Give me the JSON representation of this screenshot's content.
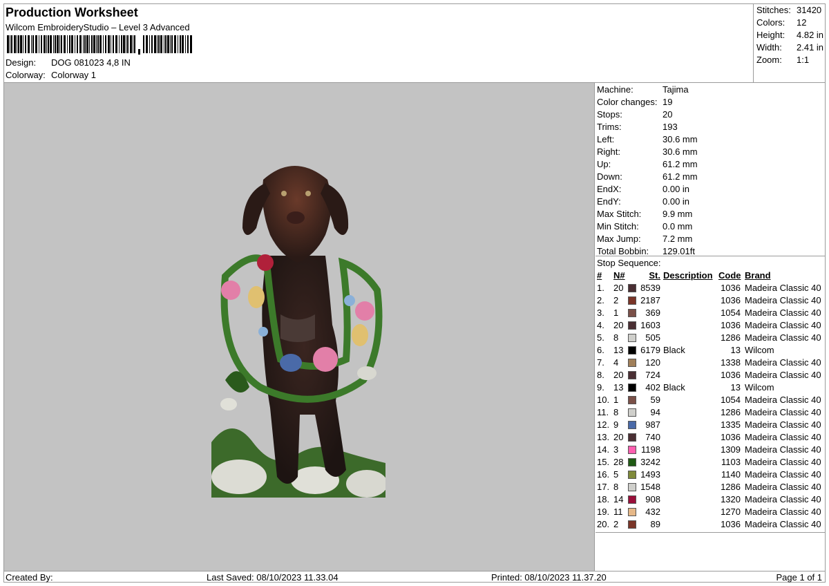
{
  "header": {
    "title": "Production Worksheet",
    "subtitle": "Wilcom EmbroideryStudio – Level 3 Advanced",
    "design_label": "Design:",
    "design_value": "DOG 081023 4,8 IN",
    "colorway_label": "Colorway:",
    "colorway_value": "Colorway 1"
  },
  "summary": [
    {
      "label": "Stitches:",
      "value": "31420"
    },
    {
      "label": "Colors:",
      "value": "12"
    },
    {
      "label": "Height:",
      "value": "4.82 in"
    },
    {
      "label": "Width:",
      "value": "2.41 in"
    },
    {
      "label": "Zoom:",
      "value": "1:1"
    }
  ],
  "machine": [
    {
      "label": "Machine:",
      "value": "Tajima"
    },
    {
      "label": "Color changes:",
      "value": "19"
    },
    {
      "label": "Stops:",
      "value": "20"
    },
    {
      "label": "Trims:",
      "value": "193"
    },
    {
      "label": "Left:",
      "value": "30.6 mm"
    },
    {
      "label": "Right:",
      "value": "30.6 mm"
    },
    {
      "label": "Up:",
      "value": "61.2 mm"
    },
    {
      "label": "Down:",
      "value": "61.2 mm"
    },
    {
      "label": "EndX:",
      "value": "0.00 in"
    },
    {
      "label": "EndY:",
      "value": "0.00 in"
    },
    {
      "label": "Max Stitch:",
      "value": "9.9 mm"
    },
    {
      "label": "Min Stitch:",
      "value": "0.0 mm"
    },
    {
      "label": "Max Jump:",
      "value": "7.2 mm"
    },
    {
      "label": "Total Bobbin:",
      "value": "129.01ft"
    }
  ],
  "stop_sequence": {
    "title": "Stop Sequence:",
    "headers": {
      "num": "#",
      "n": "N#",
      "st": "St.",
      "desc": "Description",
      "code": "Code",
      "brand": "Brand"
    },
    "rows": [
      {
        "num": "1.",
        "n": "20",
        "color": "#4a2f33",
        "st": "8539",
        "desc": "",
        "code": "1036",
        "brand": "Madeira Classic 40"
      },
      {
        "num": "2.",
        "n": "2",
        "color": "#7a3528",
        "st": "2187",
        "desc": "",
        "code": "1036",
        "brand": "Madeira Classic 40"
      },
      {
        "num": "3.",
        "n": "1",
        "color": "#7a5048",
        "st": "369",
        "desc": "",
        "code": "1054",
        "brand": "Madeira Classic 40"
      },
      {
        "num": "4.",
        "n": "20",
        "color": "#4a2f33",
        "st": "1603",
        "desc": "",
        "code": "1036",
        "brand": "Madeira Classic 40"
      },
      {
        "num": "5.",
        "n": "8",
        "color": "#cfcfcb",
        "st": "505",
        "desc": "",
        "code": "1286",
        "brand": "Madeira Classic 40"
      },
      {
        "num": "6.",
        "n": "13",
        "color": "#000000",
        "st": "6179",
        "desc": "Black",
        "code": "13",
        "brand": "Wilcom"
      },
      {
        "num": "7.",
        "n": "4",
        "color": "#a07f5a",
        "st": "120",
        "desc": "",
        "code": "1338",
        "brand": "Madeira Classic 40"
      },
      {
        "num": "8.",
        "n": "20",
        "color": "#4a2f33",
        "st": "724",
        "desc": "",
        "code": "1036",
        "brand": "Madeira Classic 40"
      },
      {
        "num": "9.",
        "n": "13",
        "color": "#000000",
        "st": "402",
        "desc": "Black",
        "code": "13",
        "brand": "Wilcom"
      },
      {
        "num": "10.",
        "n": "1",
        "color": "#7a5048",
        "st": "59",
        "desc": "",
        "code": "1054",
        "brand": "Madeira Classic 40"
      },
      {
        "num": "11.",
        "n": "8",
        "color": "#cfcfcb",
        "st": "94",
        "desc": "",
        "code": "1286",
        "brand": "Madeira Classic 40"
      },
      {
        "num": "12.",
        "n": "9",
        "color": "#4a6aa8",
        "st": "987",
        "desc": "",
        "code": "1335",
        "brand": "Madeira Classic 40"
      },
      {
        "num": "13.",
        "n": "20",
        "color": "#4a2f33",
        "st": "740",
        "desc": "",
        "code": "1036",
        "brand": "Madeira Classic 40"
      },
      {
        "num": "14.",
        "n": "3",
        "color": "#ff5fb0",
        "st": "1198",
        "desc": "",
        "code": "1309",
        "brand": "Madeira Classic 40"
      },
      {
        "num": "15.",
        "n": "28",
        "color": "#1f5a14",
        "st": "3242",
        "desc": "",
        "code": "1103",
        "brand": "Madeira Classic 40"
      },
      {
        "num": "16.",
        "n": "5",
        "color": "#7f8a3a",
        "st": "1493",
        "desc": "",
        "code": "1140",
        "brand": "Madeira Classic 40"
      },
      {
        "num": "17.",
        "n": "8",
        "color": "#cfcfcb",
        "st": "1548",
        "desc": "",
        "code": "1286",
        "brand": "Madeira Classic 40"
      },
      {
        "num": "18.",
        "n": "14",
        "color": "#9a0f3a",
        "st": "908",
        "desc": "",
        "code": "1320",
        "brand": "Madeira Classic 40"
      },
      {
        "num": "19.",
        "n": "11",
        "color": "#e6b888",
        "st": "432",
        "desc": "",
        "code": "1270",
        "brand": "Madeira Classic 40"
      },
      {
        "num": "20.",
        "n": "2",
        "color": "#7a3528",
        "st": "89",
        "desc": "",
        "code": "1036",
        "brand": "Madeira Classic 40"
      }
    ]
  },
  "footer": {
    "created_by": "Created By:",
    "last_saved": "Last Saved: 08/10/2023 11.33.04",
    "printed": "Printed: 08/10/2023 11.37.20",
    "page": "Page 1 of 1"
  }
}
